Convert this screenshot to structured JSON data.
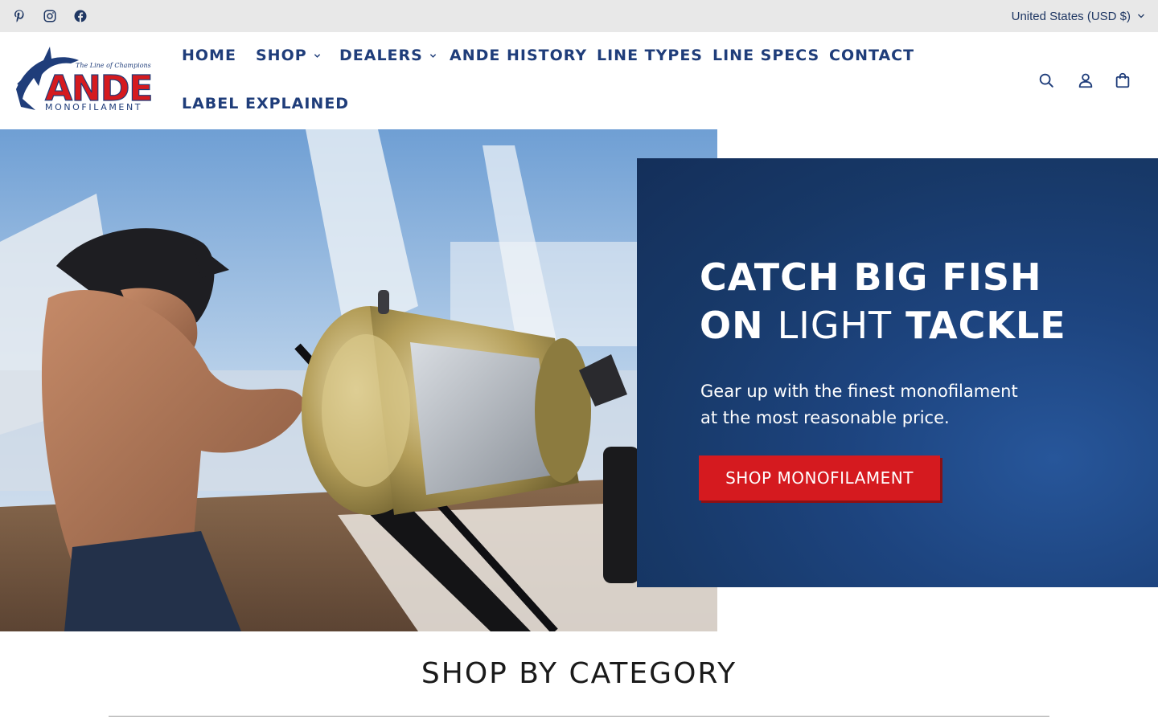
{
  "topbar": {
    "social": [
      "pinterest-icon",
      "instagram-icon",
      "facebook-icon"
    ],
    "locale": "United States (USD $)"
  },
  "brand": {
    "name": "ANDE",
    "tagline": "The Line of Champions",
    "subtitle": "MONOFILAMENT",
    "colors": {
      "red": "#d51a1f",
      "navy": "#1f3d7a"
    }
  },
  "nav": {
    "items": [
      {
        "label": "HOME",
        "dropdown": false
      },
      {
        "label": "SHOP",
        "dropdown": true
      },
      {
        "label": "DEALERS",
        "dropdown": true
      },
      {
        "label": "ANDE HISTORY",
        "dropdown": false
      },
      {
        "label": "LINE TYPES",
        "dropdown": false
      },
      {
        "label": "LINE SPECS",
        "dropdown": false
      },
      {
        "label": "CONTACT",
        "dropdown": false
      },
      {
        "label": "LABEL EXPLAINED",
        "dropdown": false
      }
    ]
  },
  "header_icons": [
    "search-icon",
    "account-icon",
    "cart-icon"
  ],
  "hero": {
    "headline_line1": "CATCH BIG FISH",
    "headline_on": "ON",
    "headline_light": "LIGHT",
    "headline_tackle": "TACKLE",
    "subcopy_line1": "Gear up with the finest monofilament",
    "subcopy_line2": "at the most reasonable price.",
    "cta_label": "SHOP MONOFILAMENT",
    "promo_bg": "#1d447f"
  },
  "section": {
    "title": "SHOP BY CATEGORY"
  }
}
